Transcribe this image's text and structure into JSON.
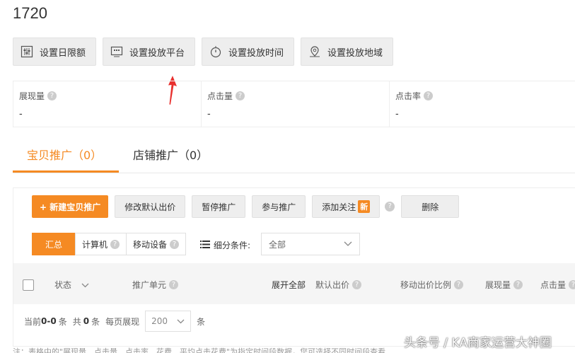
{
  "page": {
    "title": "1720"
  },
  "setting_buttons": [
    {
      "label": "设置日限额",
      "icon": "sliders-icon"
    },
    {
      "label": "设置投放平台",
      "icon": "monitor-icon"
    },
    {
      "label": "设置投放时间",
      "icon": "clock-icon"
    },
    {
      "label": "设置投放地域",
      "icon": "map-pin-icon"
    }
  ],
  "annotation": {
    "color": "#e8312f"
  },
  "stats": [
    {
      "label": "展现量",
      "value": "-"
    },
    {
      "label": "点击量",
      "value": "-"
    },
    {
      "label": "点击率",
      "value": "-"
    }
  ],
  "tabs": [
    {
      "label": "宝贝推广（0）",
      "active": true
    },
    {
      "label": "店铺推广（0）",
      "active": false
    }
  ],
  "toolbar": {
    "new_label": "+ 新建宝贝推广",
    "edit_bid_label": "修改默认出价",
    "pause_label": "暂停推广",
    "join_label": "参与推广",
    "follow_label": "添加关注",
    "new_badge": "新",
    "delete_label": "删除"
  },
  "device_filter": {
    "options": [
      "汇总",
      "计算机",
      "移动设备"
    ],
    "selected": "汇总"
  },
  "condition": {
    "label": "细分条件:",
    "value": "全部"
  },
  "table": {
    "columns": [
      "状态",
      "推广单元",
      "展开全部",
      "默认出价",
      "移动出价比例",
      "展现量",
      "点击量"
    ]
  },
  "pager": {
    "prefix": "当前",
    "range": "0-0",
    "unit1": "条",
    "total_prefix": "共",
    "total": "0",
    "unit2": "条",
    "per_page_label": "每页展现",
    "per_page": "200",
    "unit3": "条"
  },
  "note": "注：表格中的\"展现量、点击量、点击率、花费、平均点击花费\"为指定时间段数据，您可选择不同时间段查看",
  "watermark": "头条号 / KA商家运营大神圈",
  "colors": {
    "accent": "#f58a23",
    "arrow": "#e8312f"
  }
}
